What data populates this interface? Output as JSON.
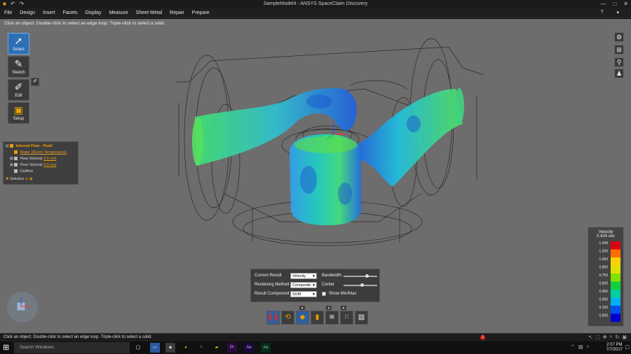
{
  "window": {
    "title": "SampleModel4 - ANSYS SpaceClaim Discovery",
    "controls": [
      "—",
      "□",
      "✕"
    ]
  },
  "menu": [
    "File",
    "Design",
    "Insert",
    "Facets",
    "Display",
    "Measure",
    "Sheet Metal",
    "Repair",
    "Prepare"
  ],
  "hint_top": "Click an object. Double-click to select an edge loop. Triple-click to select a solid.",
  "tools": [
    {
      "label": "Select",
      "icon": "arrow-icon",
      "active": true
    },
    {
      "label": "Sketch",
      "icon": "pencil-icon",
      "active": false
    },
    {
      "label": "Edit",
      "icon": "brush-icon",
      "active": false
    },
    {
      "label": "Setup",
      "icon": "cube-icon",
      "active": false
    }
  ],
  "tree": {
    "header": "Internal Flow - Fluid",
    "material": "Water (Room Temperature)",
    "inlets": [
      {
        "label": "Flow Velocity",
        "value": "0.5 m/s"
      },
      {
        "label": "Flow Velocity",
        "value": "0.5 m/s"
      }
    ],
    "outflow": "Outflow",
    "solution": "Solution"
  },
  "legend": {
    "title": "Velocity",
    "time": "0.424 sec",
    "ticks": [
      "1.349",
      "1.200",
      "1.050",
      "0.900",
      "0.750",
      "0.600",
      "0.450",
      "0.300",
      "0.150",
      "0.000"
    ],
    "colors": [
      "#e00010",
      "#ff7000",
      "#ffd000",
      "#e0e000",
      "#80e000",
      "#10d040",
      "#00d0a0",
      "#00b0f0",
      "#0050f0",
      "#0000d0"
    ]
  },
  "results": {
    "current_result_label": "Current Result",
    "current_result_value": "Velocity",
    "rendering_label": "Rendering Method",
    "rendering_value": "Composite",
    "component_label": "Result Component",
    "component_value": "SUM",
    "bandwidth_label": "Bandwidth",
    "center_label": "Center",
    "bandwidth_level": 0.7,
    "center_level": 0.55,
    "minmax_label": "Show Min/Max"
  },
  "status": {
    "message": "Click an object. Double-click to select an edge loop. Triple-click to select a solid.",
    "error_count": "1"
  },
  "taskbar": {
    "search_placeholder": "Search Windows",
    "apps": [
      "Pr",
      "Ae",
      "Ae"
    ],
    "time": "2:07 PM",
    "date": "7/7/2017"
  }
}
